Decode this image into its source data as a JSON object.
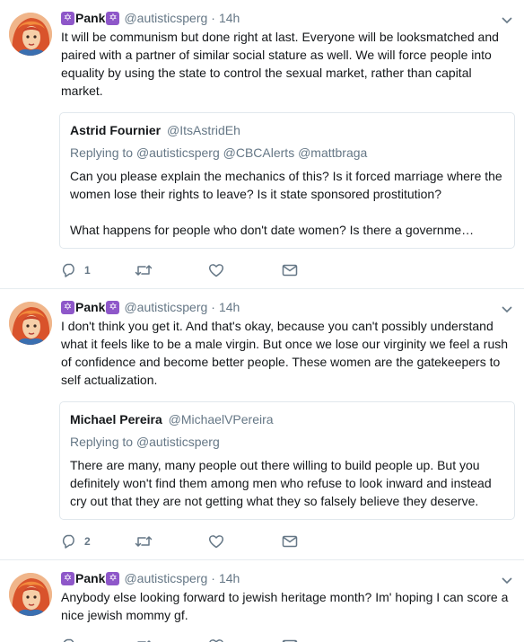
{
  "tweets": [
    {
      "name": "Pank",
      "handle": "@autisticsperg",
      "dot": "·",
      "time": "14h",
      "text": "It will be communism but done right at last. Everyone will be looksmatched and paired with a partner of similar social stature as well. We will force people into equality by using the state to control the sexual market, rather than capital market.",
      "quote": {
        "name": "Astrid Fournier",
        "handle": "@ItsAstridEh",
        "replying_label": "Replying to",
        "replying_to": "@autisticsperg @CBCAlerts @mattbraga",
        "paragraph1": "Can you please explain the mechanics of this? Is it forced marriage where the women lose their rights to leave? Is it state sponsored prostitution?",
        "paragraph2": "What happens for people who don't date women? Is there a governme…"
      },
      "reply_count": "1"
    },
    {
      "name": "Pank",
      "handle": "@autisticsperg",
      "dot": "·",
      "time": "14h",
      "text": "I don't think you get it. And that's okay, because you can't possibly understand what it feels like to be a male virgin. But once we lose our virginity we feel a rush of confidence and become better people. These women are the gatekeepers to self actualization.",
      "quote": {
        "name": "Michael Pereira",
        "handle": "@MichaelVPereira",
        "replying_label": "Replying to",
        "replying_to": "@autisticsperg",
        "paragraph1": "There are many, many people out there willing to build people up. But you definitely won't find them among men who refuse to look inward and instead cry out that they are not getting what they so falsely believe they deserve."
      },
      "reply_count": "2"
    },
    {
      "name": "Pank",
      "handle": "@autisticsperg",
      "dot": "·",
      "time": "14h",
      "text": "Anybody else looking forward to jewish heritage month? Im' hoping I can score a nice jewish mommy gf."
    }
  ],
  "icons": {
    "name_badge": "✡",
    "caret": "chevron-down-icon",
    "reply": "reply-icon",
    "retweet": "retweet-icon",
    "like": "heart-icon",
    "dm": "envelope-icon"
  },
  "colors": {
    "text": "#14171a",
    "muted": "#657786",
    "border": "#e6ecf0",
    "badge": "#8e57c9"
  }
}
